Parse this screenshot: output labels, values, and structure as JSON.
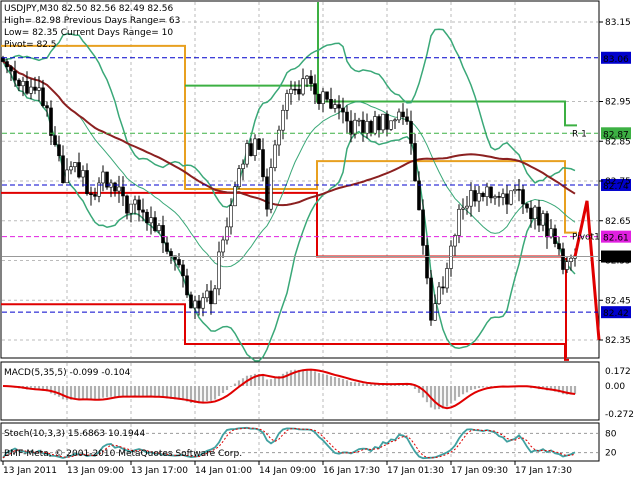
{
  "header": {
    "line1": "USDJPY,M30  82.50 82.56 82.49 82.56",
    "line2": "High= 82.98   Previous Days Range= 63",
    "line3": "Low= 82.35    Current Days Range= 10",
    "line4": "Pivot= 82.5"
  },
  "colors": {
    "green": "#3cb043",
    "blue": "#0000cc",
    "magenta": "#e020e0",
    "orange": "#e8a020",
    "red": "#e00000",
    "brown": "#8b2020",
    "band": "#3aa878",
    "teal": "#40a0a0"
  },
  "chart_data": {
    "type": "candlestick",
    "symbol": "USDJPY",
    "timeframe": "M30",
    "ylim": [
      82.3,
      83.2
    ],
    "price_ticks": [
      "83.15",
      "82.95",
      "82.85",
      "82.75",
      "82.65",
      "82.55",
      "82.45",
      "82.35"
    ],
    "time_labels": [
      "13 Jan 2011",
      "13 Jan 09:00",
      "13 Jan 17:00",
      "14 Jan 01:00",
      "14 Jan 09:00",
      "16 Jan 17:30",
      "17 Jan 01:30",
      "17 Jan 09:30",
      "17 Jan 17:30"
    ],
    "bars_per_label": 16,
    "bar_count": 144,
    "close_path": [
      [
        0,
        83.05
      ],
      [
        5,
        83.0
      ],
      [
        10,
        82.95
      ],
      [
        15,
        82.75
      ],
      [
        19,
        82.78
      ],
      [
        22,
        82.7
      ],
      [
        25,
        82.75
      ],
      [
        30,
        82.7
      ],
      [
        37,
        82.65
      ],
      [
        44,
        82.55
      ],
      [
        47,
        82.45
      ],
      [
        52,
        82.45
      ],
      [
        55,
        82.6
      ],
      [
        59,
        82.8
      ],
      [
        64,
        82.85
      ],
      [
        66,
        82.7
      ],
      [
        70,
        82.95
      ],
      [
        75,
        83.0
      ],
      [
        80,
        82.95
      ],
      [
        85,
        82.9
      ],
      [
        90,
        82.88
      ],
      [
        95,
        82.9
      ],
      [
        100,
        82.92
      ],
      [
        102,
        82.85
      ],
      [
        105,
        82.6
      ],
      [
        107,
        82.4
      ],
      [
        110,
        82.5
      ],
      [
        115,
        82.7
      ],
      [
        119,
        82.72
      ],
      [
        125,
        82.72
      ],
      [
        130,
        82.7
      ],
      [
        135,
        82.65
      ],
      [
        140,
        82.55
      ],
      [
        143,
        82.56
      ]
    ],
    "levels": [
      {
        "label": "83.06",
        "price": 83.06,
        "color": "#0000cc",
        "text_color": "#ffffff"
      },
      {
        "label": "82.87",
        "price": 82.87,
        "color": "#3cb043",
        "text_color": "#ffffff",
        "tag": "R 1"
      },
      {
        "label": "82.74",
        "price": 82.74,
        "color": "#0000cc",
        "text_color": "#ffffff"
      },
      {
        "label": "82.61",
        "price": 82.61,
        "color": "#e020e0",
        "text_color": "#ffffff",
        "tag": "Pivot1"
      },
      {
        "label": "82.56",
        "price": 82.56,
        "color": "#000000",
        "text_color": "#ffffff"
      },
      {
        "label": "82.42",
        "price": 82.42,
        "color": "#0000cc",
        "text_color": "#ffffff"
      }
    ],
    "steps": [
      {
        "name": "daily-high",
        "color": "#e8a020",
        "segments": [
          [
            0,
            46,
            83.09
          ],
          [
            46,
            79,
            82.73
          ],
          [
            79,
            141,
            82.8
          ],
          [
            141,
            144,
            82.62
          ]
        ]
      },
      {
        "name": "daily-mid",
        "color": "#e00000",
        "segments": [
          [
            0,
            46,
            82.72
          ],
          [
            79,
            141,
            82.56
          ]
        ]
      },
      {
        "name": "daily-low",
        "color": "#e00000",
        "segments": [
          [
            0,
            46,
            82.44
          ],
          [
            46,
            79,
            82.34
          ],
          [
            141,
            142,
            82.3
          ]
        ]
      },
      {
        "name": "resistance",
        "color": "#3cb043",
        "segments": [
          [
            46,
            79,
            82.99
          ],
          [
            79,
            141,
            82.95
          ],
          [
            141,
            144,
            82.89
          ]
        ]
      }
    ],
    "forecast": [
      [
        143,
        82.56
      ],
      [
        146,
        82.7
      ],
      [
        149,
        82.35
      ]
    ],
    "macd": {
      "label": "MACD(5,35,5) -0.099 -0.104",
      "ticks": [
        "0.172",
        "0.00",
        "-0.272"
      ],
      "range": [
        -0.3,
        0.2
      ]
    },
    "stoch": {
      "label": "Stoch(10,3,3) 15.6863 10.1944",
      "ticks": [
        "80",
        "20"
      ]
    }
  },
  "footer": {
    "copyright": "BMF-Meta, © 2001-2010 MetaQuotes Software Corp."
  }
}
